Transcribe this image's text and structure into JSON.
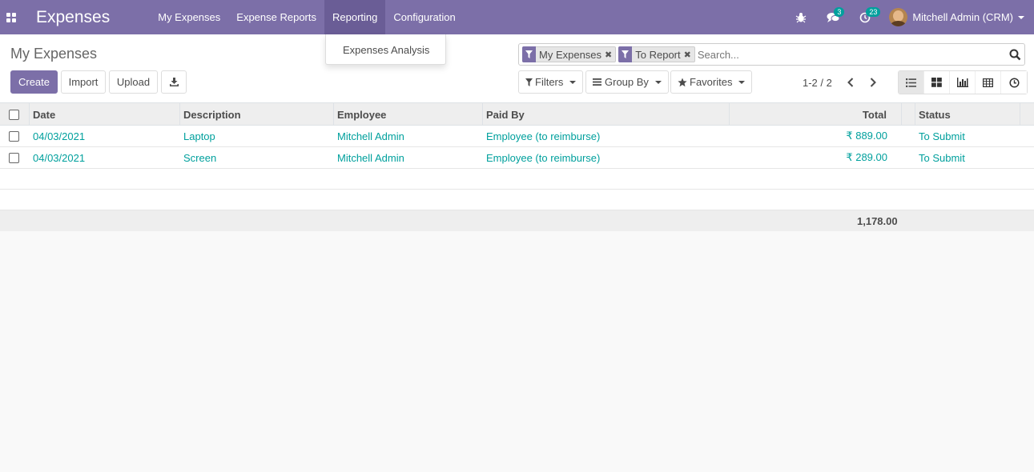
{
  "navbar": {
    "app_name": "Expenses",
    "menu": [
      {
        "label": "My Expenses"
      },
      {
        "label": "Expense Reports"
      },
      {
        "label": "Reporting"
      },
      {
        "label": "Configuration"
      }
    ],
    "messages_count": "3",
    "activities_count": "23",
    "user_name": "Mitchell Admin (CRM)"
  },
  "dropdown": {
    "items": [
      {
        "label": "Expenses Analysis"
      }
    ]
  },
  "control": {
    "title": "My Expenses",
    "create_label": "Create",
    "import_label": "Import",
    "upload_label": "Upload",
    "search": {
      "facets": [
        {
          "label": "My Expenses"
        },
        {
          "label": "To Report"
        }
      ],
      "placeholder": "Search..."
    },
    "filters_label": "Filters",
    "groupby_label": "Group By",
    "favorites_label": "Favorites",
    "pager": "1-2 / 2"
  },
  "table": {
    "headers": {
      "date": "Date",
      "description": "Description",
      "employee": "Employee",
      "paid_by": "Paid By",
      "total": "Total",
      "status": "Status"
    },
    "rows": [
      {
        "date": "04/03/2021",
        "description": "Laptop",
        "employee": "Mitchell Admin",
        "paid_by": "Employee (to reimburse)",
        "total": "₹ 889.00",
        "status": "To Submit"
      },
      {
        "date": "04/03/2021",
        "description": "Screen",
        "employee": "Mitchell Admin",
        "paid_by": "Employee (to reimburse)",
        "total": "₹ 289.00",
        "status": "To Submit"
      }
    ],
    "sum_total": "1,178.00"
  },
  "colors": {
    "brand": "#7c6fa8",
    "link": "#00a09d"
  }
}
